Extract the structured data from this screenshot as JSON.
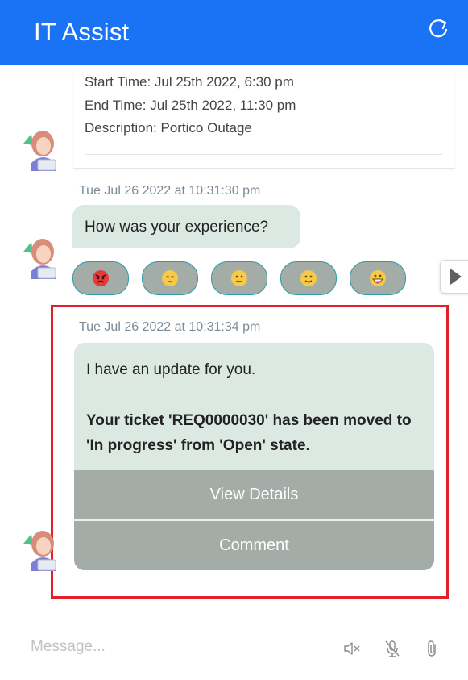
{
  "header": {
    "title": "IT Assist",
    "refresh_icon": "refresh-icon"
  },
  "event": {
    "start_time": "Start Time: Jul 25th 2022, 6:30 pm",
    "end_time": "End Time: Jul 25th 2022, 11:30 pm",
    "description": "Description: Portico Outage"
  },
  "feedback": {
    "timestamp": "Tue Jul 26 2022 at 10:31:30 pm",
    "question": "How was your experience?",
    "emojis": [
      "angry-face",
      "sad-face",
      "neutral-face",
      "slightly-smiling-face",
      "grinning-face"
    ]
  },
  "update": {
    "timestamp": "Tue Jul 26 2022 at 10:31:34 pm",
    "intro": "I have an update for you.",
    "body": "Your ticket 'REQ0000030' has been moved to 'In progress' from 'Open' state.",
    "buttons": {
      "view_details": "View Details",
      "comment": "Comment"
    }
  },
  "composer": {
    "placeholder": "Message..."
  },
  "colors": {
    "header_bg": "#1a73f5",
    "bubble_bg": "#dce9e3",
    "action_bg": "#a3aca7",
    "highlight": "#e0202a"
  }
}
